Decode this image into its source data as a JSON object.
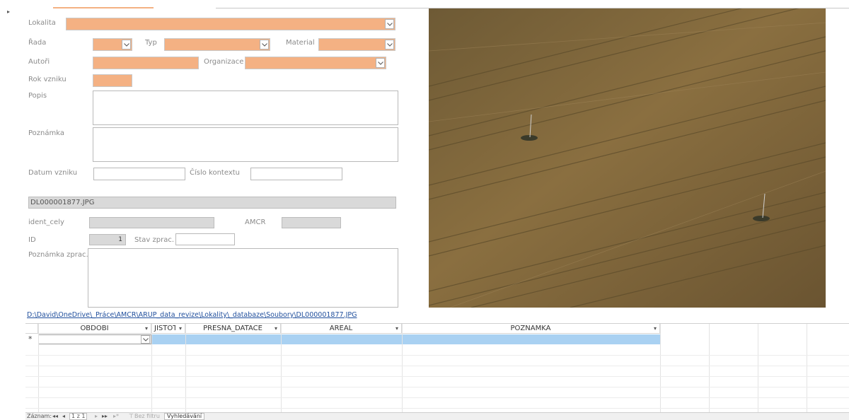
{
  "form": {
    "lokalita_label": "Lokalita",
    "rada_label": "Řada",
    "typ_label": "Typ",
    "material_label": "Material",
    "autori_label": "Autoři",
    "organizace_label": "Organizace",
    "rok_vzniku_label": "Rok vzniku",
    "popis_label": "Popis",
    "poznamka_label": "Poznámka",
    "datum_vzniku_label": "Datum vzniku",
    "cislo_kontextu_label": "Číslo kontextu",
    "filename": "DL000001877.JPG",
    "ident_cely_label": "ident_cely",
    "amcr_label": "AMCR",
    "id_label": "ID",
    "id_value": "1",
    "stav_zprac_label": "Stav zprac.",
    "poznamka_zprac_label": "Poznámka zprac.",
    "file_path": "D:\\David\\OneDrive\\_Práce\\AMCR\\ARUP_data_revize\\Lokality\\_databaze\\Soubory\\DL000001877.JPG"
  },
  "datasheet": {
    "columns": [
      "OBDOBI",
      "JISTOTA",
      "PRESNA_DATACE",
      "AREAL",
      "POZNAMKA"
    ],
    "new_record_marker": "*"
  },
  "navigation": {
    "record_label": "Záznam:",
    "first": "◂◂",
    "prev": "◂",
    "position": "1 z 1",
    "next": "▸",
    "last": "▸▸",
    "new": "▸*",
    "filter_label": "Bez filtru",
    "search_label": "Vyhledávání"
  },
  "colors": {
    "required_field": "#f4b183",
    "readonly_field": "#d9d9d9",
    "selected_row": "#a9d1f2",
    "hyperlink": "#1f4e9c"
  }
}
